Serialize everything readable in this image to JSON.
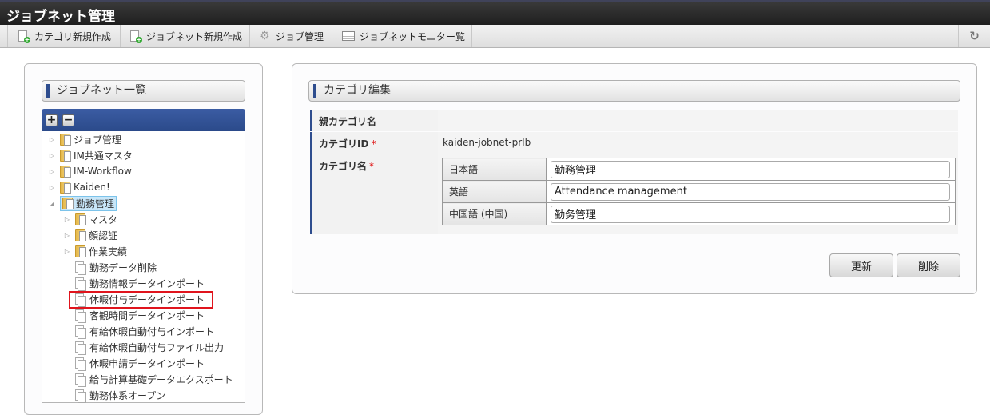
{
  "header": {
    "title": "ジョブネット管理"
  },
  "toolbar": {
    "items": [
      {
        "label": "カテゴリ新規作成",
        "icon": "new-document-icon"
      },
      {
        "label": "ジョブネット新規作成",
        "icon": "new-document-icon"
      },
      {
        "label": "ジョブ管理",
        "icon": "gear-icon"
      },
      {
        "label": "ジョブネットモニター覧",
        "icon": "list-icon"
      }
    ],
    "refresh_icon": "refresh-icon"
  },
  "left": {
    "title": "ジョブネット一覧",
    "expand": "+",
    "collapse": "−",
    "tree": [
      {
        "label": "ジョブ管理"
      },
      {
        "label": "IM共通マスタ"
      },
      {
        "label": "IM-Workflow"
      },
      {
        "label": "Kaiden!"
      },
      {
        "label": "勤務管理"
      },
      {
        "label": "マスタ"
      },
      {
        "label": "顔認証"
      },
      {
        "label": "作業実績"
      },
      {
        "label": "勤務データ削除"
      },
      {
        "label": "勤務情報データインポート"
      },
      {
        "label": "休暇付与データインポート"
      },
      {
        "label": "客観時間データインポート"
      },
      {
        "label": "有給休暇自動付与インポート"
      },
      {
        "label": "有給休暇自動付与ファイル出力"
      },
      {
        "label": "休暇申請データインポート"
      },
      {
        "label": "給与計算基礎データエクスポート"
      },
      {
        "label": "勤務体系オープン"
      }
    ]
  },
  "right": {
    "title": "カテゴリ編集",
    "parent_label": "親カテゴリ名",
    "parent_value": "",
    "id_label": "カテゴリID",
    "id_value": "kaiden-jobnet-prlb",
    "required": "*",
    "name_label": "カテゴリ名",
    "names": [
      {
        "lang": "日本語",
        "value": "勤務管理"
      },
      {
        "lang": "英語",
        "value": "Attendance management"
      },
      {
        "lang": "中国語 (中国)",
        "value": "勤务管理"
      }
    ],
    "update": "更新",
    "delete": "削除"
  }
}
